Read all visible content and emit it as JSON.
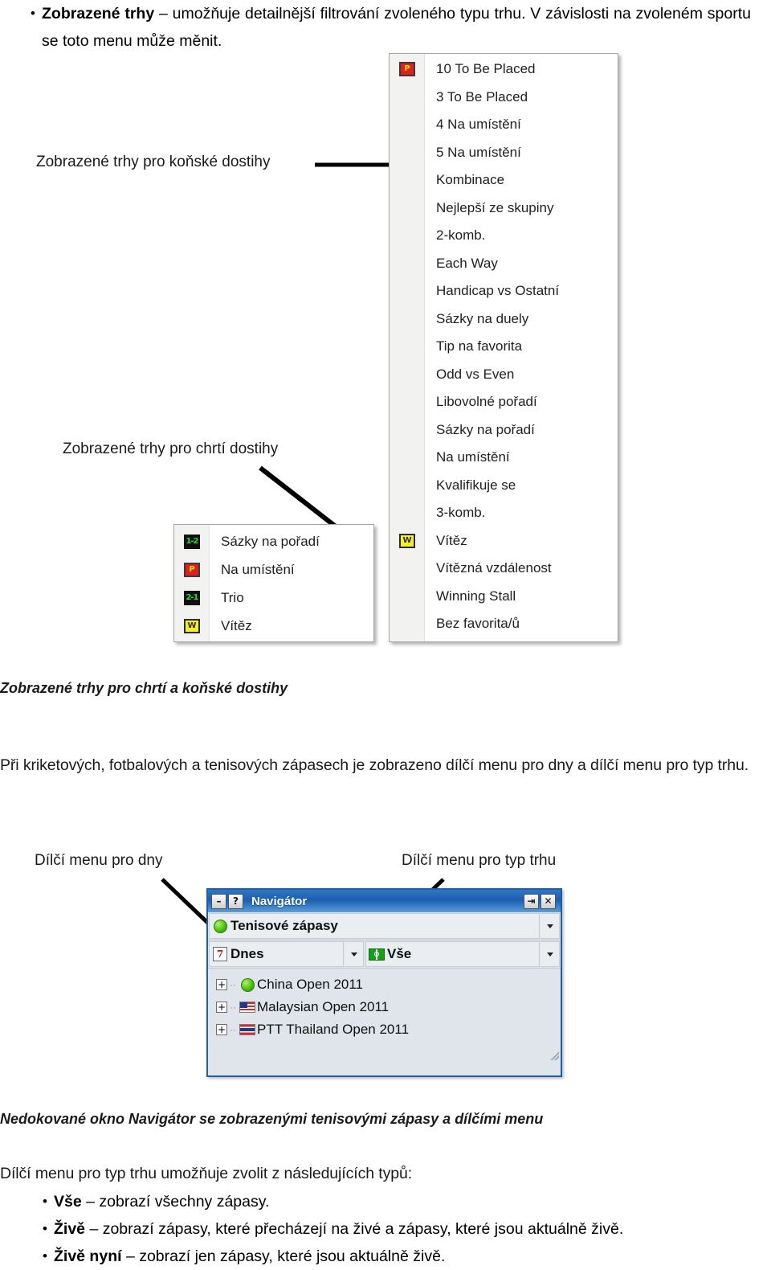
{
  "intro": {
    "bullet_glyph": "•",
    "term": "Zobrazené trhy",
    "rest": " – umožňuje detailnější filtrování zvoleného typu trhu. V závislosti na zvoleném sportu se toto menu může měnit."
  },
  "callouts": {
    "horse": "Zobrazené trhy pro koňské dostihy",
    "greyhound": "Zobrazené trhy pro chrtí dostihy",
    "days_submenu": "Dílčí menu pro dny",
    "market_type_submenu": "Dílčí menu pro typ trhu"
  },
  "captions": {
    "racing_caption": "Zobrazené trhy pro chrtí a koňské dostihy",
    "navigator_caption": "Nedokované okno Navigátor se zobrazenými tenisovými zápasy a dílčími menu"
  },
  "paragraphs": {
    "sports_menu": "Při kriketových, fotbalových a tenisových zápasech je zobrazeno dílčí menu pro dny a dílčí menu pro typ trhu.",
    "types_intro": "Dílčí menu pro typ trhu umožňuje zvolit z následujících typů:"
  },
  "type_list": [
    {
      "term": "Vše",
      "rest": " – zobrazí všechny zápasy."
    },
    {
      "term": "Živě",
      "rest": " – zobrazí zápasy, které přecházejí na živé a zápasy, které jsou aktuálně živě."
    },
    {
      "term": "Živě nyní",
      "rest": " – zobrazí jen zápasy, které jsou aktuálně živě."
    }
  ],
  "horse_menu": {
    "items": [
      {
        "label": "10 To Be Placed",
        "icon": "placed-p-icon",
        "icon_text": "P"
      },
      {
        "label": "3 To Be Placed",
        "icon": "",
        "icon_text": ""
      },
      {
        "label": "4 Na umístění",
        "icon": "",
        "icon_text": ""
      },
      {
        "label": "5 Na umístění",
        "icon": "",
        "icon_text": ""
      },
      {
        "label": "Kombinace",
        "icon": "",
        "icon_text": ""
      },
      {
        "label": "Nejlepší ze skupiny",
        "icon": "",
        "icon_text": ""
      },
      {
        "label": "2-komb.",
        "icon": "",
        "icon_text": ""
      },
      {
        "label": "Each Way",
        "icon": "",
        "icon_text": ""
      },
      {
        "label": "Handicap vs Ostatní",
        "icon": "",
        "icon_text": ""
      },
      {
        "label": "Sázky na duely",
        "icon": "",
        "icon_text": ""
      },
      {
        "label": "Tip na favorita",
        "icon": "",
        "icon_text": ""
      },
      {
        "label": "Odd vs Even",
        "icon": "",
        "icon_text": ""
      },
      {
        "label": "Libovolné pořadí",
        "icon": "",
        "icon_text": ""
      },
      {
        "label": "Sázky na pořadí",
        "icon": "",
        "icon_text": ""
      },
      {
        "label": "Na umístění",
        "icon": "",
        "icon_text": ""
      },
      {
        "label": "Kvalifikuje se",
        "icon": "",
        "icon_text": ""
      },
      {
        "label": "3-komb.",
        "icon": "",
        "icon_text": ""
      },
      {
        "label": "Vítěz",
        "icon": "winner-w-icon",
        "icon_text": "W"
      },
      {
        "label": "Vítězná vzdálenost",
        "icon": "",
        "icon_text": ""
      },
      {
        "label": "Winning Stall",
        "icon": "",
        "icon_text": ""
      },
      {
        "label": "Bez favorita/ů",
        "icon": "",
        "icon_text": ""
      }
    ]
  },
  "greyhound_menu": {
    "items": [
      {
        "label": "Sázky na pořadí",
        "icon": "forecast-1-2-icon",
        "icon_text": "1-2"
      },
      {
        "label": "Na umístění",
        "icon": "placed-p-icon",
        "icon_text": "P"
      },
      {
        "label": "Trio",
        "icon": "reverse-2-1-icon",
        "icon_text": "2-1"
      },
      {
        "label": "Vítěz",
        "icon": "winner-w-icon",
        "icon_text": "W"
      }
    ]
  },
  "navigator": {
    "title": "Navigátor",
    "title_buttons": {
      "minimize": "–",
      "help": "?",
      "pin": "⇥",
      "close": "✕"
    },
    "sport_combo": {
      "label": "Tenisové zápasy",
      "icon": "green-ball-icon"
    },
    "day_combo": {
      "label": "Dnes",
      "icon": "calendar-icon",
      "icon_text": "7"
    },
    "type_combo": {
      "label": "Vše",
      "icon": "court-icon"
    },
    "tree": [
      {
        "label": "China Open 2011",
        "icon": "green-ball-icon",
        "expander": "+"
      },
      {
        "label": "Malaysian Open 2011",
        "icon": "flag-malaysia-icon",
        "expander": "+"
      },
      {
        "label": "PTT Thailand Open 2011",
        "icon": "flag-thailand-icon",
        "expander": "+"
      }
    ]
  },
  "colors": {
    "title_bar_blue": "#1d5fae",
    "menu_bg": "#ffffff",
    "nav_body": "#dfe5ea",
    "icon_red": "#e02020",
    "icon_yellow": "#f5ee2a",
    "icon_green": "#22e022"
  }
}
